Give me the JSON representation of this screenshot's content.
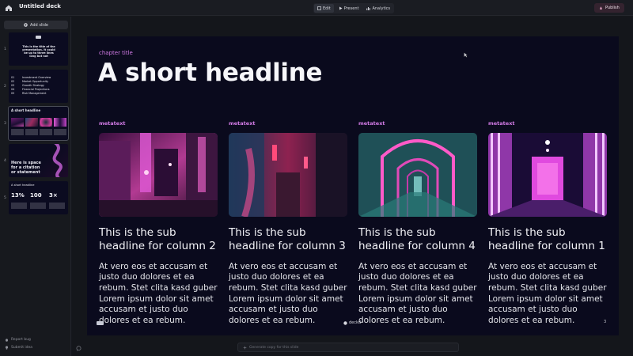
{
  "app": {
    "title": "Untitled deck"
  },
  "modes": [
    {
      "label": "Edit",
      "icon": "edit-icon"
    },
    {
      "label": "Present",
      "icon": "play-icon"
    },
    {
      "label": "Analytics",
      "icon": "bar-chart-icon"
    }
  ],
  "publish": {
    "label": "Publish",
    "icon": "rocket-icon"
  },
  "sidebar": {
    "add_slide": "Add slide",
    "slides": [
      {
        "num": "1",
        "text": "This is the title of the presentation. It could be up to three lines long but not"
      },
      {
        "num": "2",
        "items": [
          "01",
          "Investment Overview",
          "02",
          "Market Opportunity",
          "03",
          "Growth Strategy",
          "04",
          "Financial Projections",
          "05",
          "Risk Management"
        ]
      },
      {
        "num": "3",
        "text": "A short headline"
      },
      {
        "num": "4",
        "text": "Here is space for a citation or statement"
      },
      {
        "num": "5",
        "title": "A short headline",
        "stats": [
          "13%",
          "100",
          "3×"
        ]
      }
    ],
    "footer": {
      "report_bug": "Report bug",
      "submit_idea": "Submit idea"
    }
  },
  "slide": {
    "chapter": "chapter title",
    "headline": "A short headline",
    "columns": [
      {
        "meta": "metatext",
        "sub": "This is the sub headline for column 2",
        "body": "At vero eos et accusam et justo duo dolores et ea rebum. Stet clita kasd guber Lorem ipsum dolor sit amet accusam et justo duo dolores et ea rebum."
      },
      {
        "meta": "metatext",
        "sub": "This is the sub headline for column 3",
        "body": "At vero eos et accusam et justo duo dolores et ea rebum. Stet clita kasd guber Lorem ipsum dolor sit amet accusam et justo duo dolores et ea rebum."
      },
      {
        "meta": "metatext",
        "sub": "This is the sub headline for column 4",
        "body": "At vero eos et accusam et justo duo dolores et ea rebum. Stet clita kasd guber Lorem ipsum dolor sit amet accusam et justo duo dolores et ea rebum."
      },
      {
        "meta": "metatext",
        "sub": "This is the sub headline for column 1",
        "body": "At vero eos et accusam et justo duo dolores et ea rebum. Stet clita kasd guber Lorem ipsum dolor sit amet accusam et justo duo dolores et ea rebum."
      }
    ],
    "brand": "deckd",
    "page": "3"
  },
  "prompt": {
    "placeholder": "Generate copy for this slide"
  },
  "colors": {
    "accent": "#d27be6",
    "slide_bg": "#0a0a1d",
    "app_bg": "#15171c"
  }
}
